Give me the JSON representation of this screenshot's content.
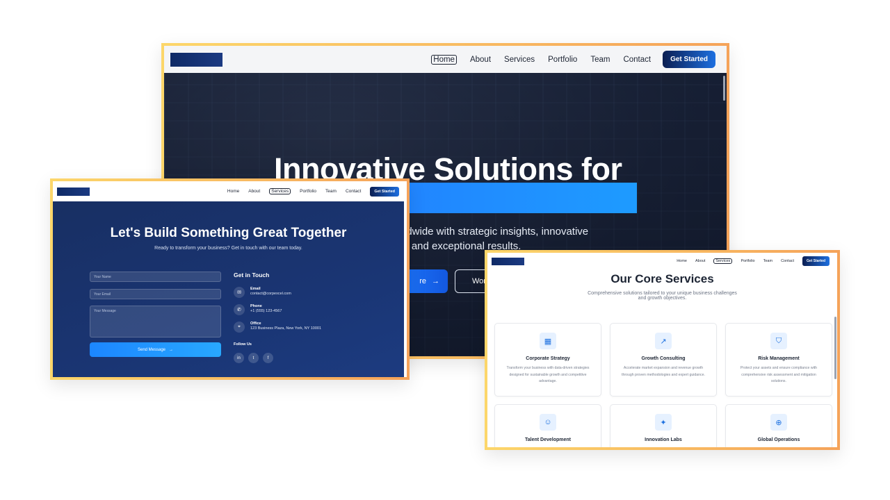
{
  "nav": {
    "links": [
      "Home",
      "About",
      "Services",
      "Portfolio",
      "Team",
      "Contact"
    ],
    "cta": "Get Started"
  },
  "hero": {
    "title": "Innovative Solutions for",
    "subtitle_line1": "rldwide with strategic insights, innovative",
    "subtitle_line2": "s, and exceptional results.",
    "button_primary": "re",
    "button_secondary": "Wor"
  },
  "contact": {
    "title": "Let's Build Something Great Together",
    "subtitle": "Ready to transform your business? Get in touch with our team today.",
    "name_placeholder": "Your Name",
    "email_placeholder": "Your Email",
    "message_placeholder": "Your Message",
    "send_label": "Send Message",
    "get_in_touch": "Get in Touch",
    "email_label": "Email",
    "email_value": "contact@corpexcel.com",
    "phone_label": "Phone",
    "phone_value": "+1 (555) 123-4567",
    "office_label": "Office",
    "office_value": "123 Business Plaza, New York, NY 10001",
    "follow_label": "Follow Us",
    "social_icons": [
      "linkedin-icon",
      "twitter-icon",
      "facebook-icon"
    ]
  },
  "services": {
    "title": "Our Core Services",
    "subtitle_line1": "Comprehensive solutions tailored to your unique business challenges",
    "subtitle_line2": "and growth objectives.",
    "cards": [
      {
        "title": "Corporate Strategy",
        "desc": "Transform your business with data-driven strategies designed for sustainable growth and competitive advantage.",
        "icon": "building-icon"
      },
      {
        "title": "Growth Consulting",
        "desc": "Accelerate market expansion and revenue growth through proven methodologies and expert guidance.",
        "icon": "trend-up-icon"
      },
      {
        "title": "Risk Management",
        "desc": "Protect your assets and ensure compliance with comprehensive risk assessment and mitigation solutions.",
        "icon": "shield-icon"
      },
      {
        "title": "Talent Development",
        "desc": "",
        "icon": "users-icon"
      },
      {
        "title": "Innovation Labs",
        "desc": "",
        "icon": "lightbulb-icon"
      },
      {
        "title": "Global Operations",
        "desc": "",
        "icon": "globe-icon"
      }
    ]
  },
  "colors": {
    "accent": "#1f7cff",
    "navy": "#0f2a66",
    "frame_border_start": "#fcd66a",
    "frame_border_end": "#f5a35a"
  }
}
